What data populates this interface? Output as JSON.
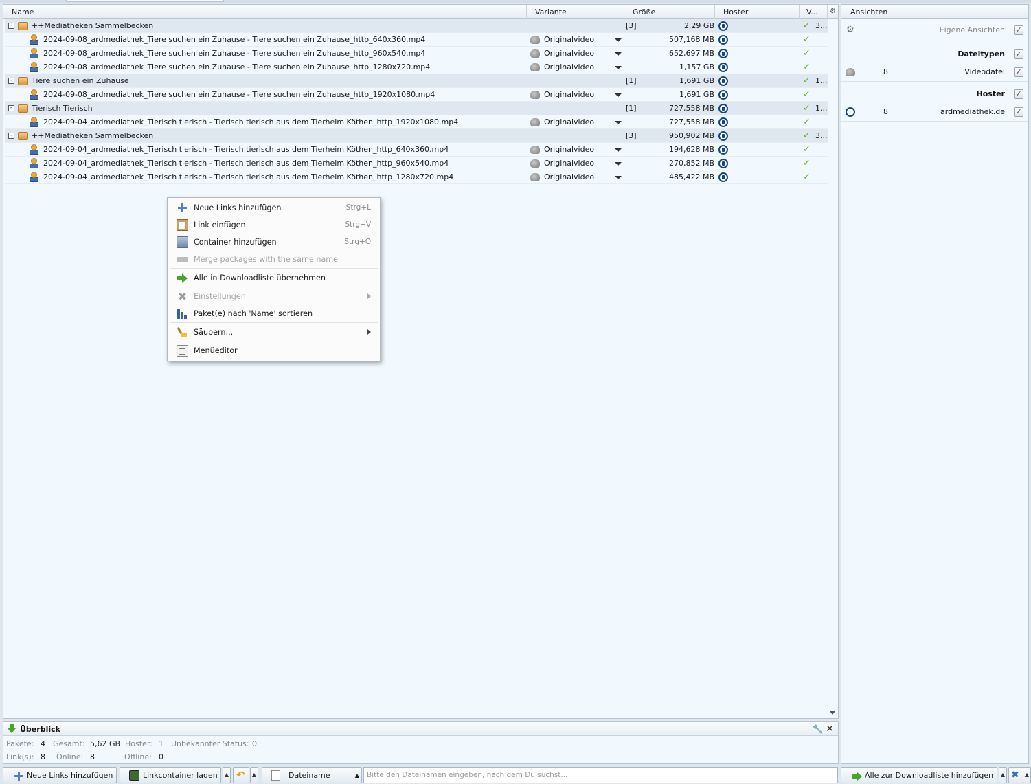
{
  "columns": {
    "name": "Name",
    "variant": "Variante",
    "size": "Größe",
    "hoster": "Hoster",
    "avail": "V..."
  },
  "rows": [
    {
      "type": "package",
      "name": "++Mediatheken Sammelbecken",
      "count": "[3]",
      "size": "2,29 GB",
      "avail": "3..."
    },
    {
      "type": "link",
      "name": "2024-09-08_ardmediathek_Tiere suchen ein Zuhause - Tiere suchen ein Zuhause_http_640x360.mp4",
      "variant": "Originalvideo",
      "size": "507,168 MB"
    },
    {
      "type": "link",
      "name": "2024-09-08_ardmediathek_Tiere suchen ein Zuhause - Tiere suchen ein Zuhause_http_960x540.mp4",
      "variant": "Originalvideo",
      "size": "652,697 MB"
    },
    {
      "type": "link",
      "name": "2024-09-08_ardmediathek_Tiere suchen ein Zuhause - Tiere suchen ein Zuhause_http_1280x720.mp4",
      "variant": "Originalvideo",
      "size": "1,157 GB"
    },
    {
      "type": "package",
      "name": "Tiere suchen ein Zuhause",
      "count": "[1]",
      "size": "1,691 GB",
      "avail": "1..."
    },
    {
      "type": "link",
      "name": "2024-09-08_ardmediathek_Tiere suchen ein Zuhause - Tiere suchen ein Zuhause_http_1920x1080.mp4",
      "variant": "Originalvideo",
      "size": "1,691 GB"
    },
    {
      "type": "package",
      "name": "Tierisch Tierisch",
      "count": "[1]",
      "size": "727,558 MB",
      "avail": "1..."
    },
    {
      "type": "link",
      "name": "2024-09-04_ardmediathek_Tierisch tierisch - Tierisch tierisch aus dem Tierheim Köthen_http_1920x1080.mp4",
      "variant": "Originalvideo",
      "size": "727,558 MB"
    },
    {
      "type": "package",
      "name": "++Mediatheken Sammelbecken",
      "count": "[3]",
      "size": "950,902 MB",
      "avail": "3..."
    },
    {
      "type": "link",
      "name": "2024-09-04_ardmediathek_Tierisch tierisch - Tierisch tierisch aus dem Tierheim Köthen_http_640x360.mp4",
      "variant": "Originalvideo",
      "size": "194,628 MB"
    },
    {
      "type": "link",
      "name": "2024-09-04_ardmediathek_Tierisch tierisch - Tierisch tierisch aus dem Tierheim Köthen_http_960x540.mp4",
      "variant": "Originalvideo",
      "size": "270,852 MB"
    },
    {
      "type": "link",
      "name": "2024-09-04_ardmediathek_Tierisch tierisch - Tierisch tierisch aus dem Tierheim Köthen_http_1280x720.mp4",
      "variant": "Originalvideo",
      "size": "485,422 MB"
    }
  ],
  "context_menu": {
    "items": [
      {
        "label": "Neue Links hinzufügen",
        "shortcut": "Strg+L",
        "icon": "plus-icon"
      },
      {
        "label": "Link einfügen",
        "shortcut": "Strg+V",
        "icon": "clipboard-icon"
      },
      {
        "label": "Container hinzufügen",
        "shortcut": "Strg+O",
        "icon": "container-icon"
      },
      {
        "label": "Merge packages with the same name",
        "disabled": true,
        "icon": "merge-icon"
      },
      {
        "label": "Alle in Downloadliste übernehmen",
        "icon": "green-arrow-icon"
      },
      {
        "label": "Einstellungen",
        "disabled": true,
        "submenu": true,
        "icon": "tools-icon"
      },
      {
        "label": "Paket(e) nach 'Name' sortieren",
        "icon": "sort-icon"
      },
      {
        "label": "Säubern...",
        "submenu": true,
        "icon": "broom-icon"
      },
      {
        "label": "Menüeditor",
        "icon": "menu-editor-icon"
      }
    ]
  },
  "views_panel": {
    "title": "Ansichten",
    "own_views": "Eigene Ansichten",
    "filetypes_header": "Dateitypen",
    "filetype": {
      "count": "8",
      "label": "Videodatei"
    },
    "hoster_header": "Hoster",
    "hoster": {
      "count": "8",
      "label": "ardmediathek.de"
    }
  },
  "overview": {
    "title": "Überblick",
    "packages_label": "Pakete:",
    "packages": "4",
    "total_label": "Gesamt:",
    "total": "5,62 GB",
    "hoster_label": "Hoster:",
    "hoster": "1",
    "unknown_label": "Unbekannter Status:",
    "unknown": "0",
    "links_label": "Link(s):",
    "links": "8",
    "online_label": "Online:",
    "online": "8",
    "offline_label": "Offline:",
    "offline": "0"
  },
  "toolbar": {
    "add_links": "Neue Links hinzufügen",
    "load_container": "Linkcontainer laden",
    "search_field": "Dateiname",
    "search_placeholder": "Bitte den Dateinamen eingeben, nach dem Du suchst...",
    "add_all": "Alle zur Downloadliste hinzufügen"
  },
  "colors": {
    "package_row": "#dfe8f0",
    "link_row": "#f1f9fe",
    "check_green": "#61b12b",
    "hoster_blue": "#13457e"
  }
}
